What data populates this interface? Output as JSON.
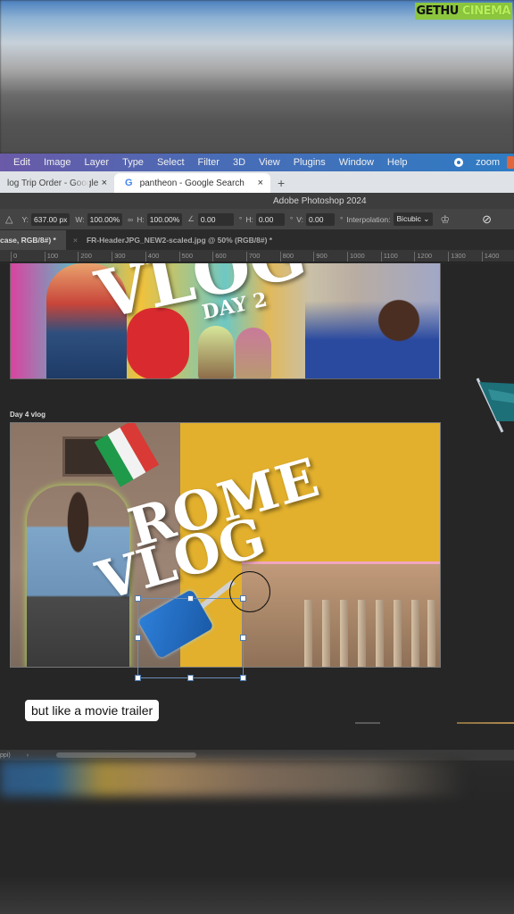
{
  "watermark": {
    "part1": "GETHU",
    "part2": "CINEMA"
  },
  "menubar": {
    "items": [
      "Edit",
      "Image",
      "Layer",
      "Type",
      "Select",
      "Filter",
      "3D",
      "View",
      "Plugins",
      "Window",
      "Help"
    ],
    "zoom_label": "zoom"
  },
  "browser": {
    "tabs": [
      {
        "title": "log Trip Order - Google",
        "close": "×"
      },
      {
        "title": "pantheon - Google Search",
        "icon": "G",
        "close": "×"
      }
    ],
    "new_tab": "+"
  },
  "photoshop": {
    "title": "Adobe Photoshop 2024",
    "options": {
      "y_label": "Y:",
      "y_value": "637.00 px",
      "w_label": "W:",
      "w_value": "100.00%",
      "link_symbol": "∞",
      "h_label": "H:",
      "h_value": "100.00%",
      "angle_symbol": "∠",
      "angle_value": "0.00",
      "deg": "°",
      "skew_h_label": "H:",
      "skew_h_value": "0.00",
      "skew_v_label": "V:",
      "skew_v_value": "0.00",
      "interp_label": "Interpolation:",
      "interp_value": "Bicubic"
    },
    "doc_tabs": [
      {
        "title": "case, RGB/8#) *",
        "active": true
      },
      {
        "title": "FR-HeaderJPG_NEW2-scaled.jpg @ 50% (RGB/8#) *",
        "active": false
      }
    ],
    "ruler_ticks": [
      "0",
      "100",
      "200",
      "300",
      "400",
      "500",
      "600",
      "700",
      "800",
      "900",
      "1000",
      "1100",
      "1200",
      "1300",
      "1400"
    ],
    "status_text": "ppi)",
    "status_arrow": "›"
  },
  "canvas": {
    "artboard1": {
      "title_text": "VLOG",
      "subtitle": "DAY 2"
    },
    "artboard2_label": "Day 4 vlog",
    "artboard2": {
      "line1": "ROME",
      "line2": "VLOG"
    }
  },
  "caption": "but like a movie trailer"
}
